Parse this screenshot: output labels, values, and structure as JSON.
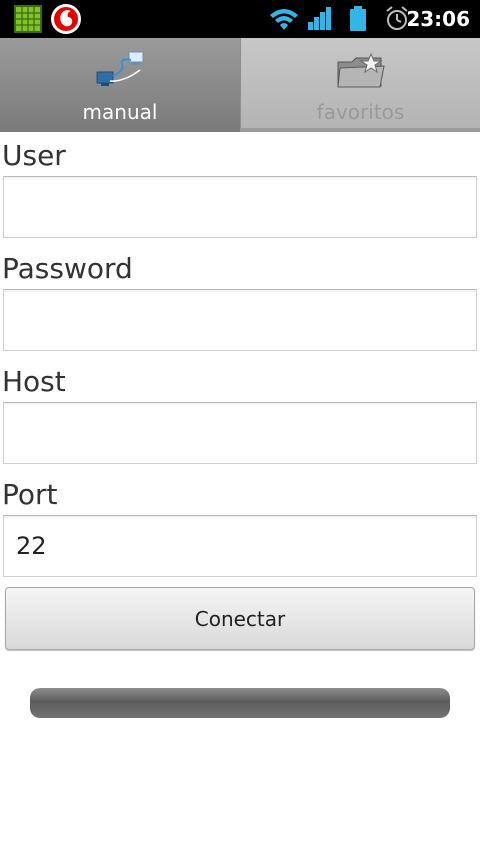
{
  "status_bar": {
    "time": "23:06",
    "icons": [
      "app-grid-icon",
      "vodafone-icon",
      "wifi-icon",
      "signal-icon",
      "battery-icon",
      "alarm-icon"
    ]
  },
  "tabs": [
    {
      "label": "manual",
      "icon": "network-icon",
      "active": true
    },
    {
      "label": "favoritos",
      "icon": "folder-icon",
      "active": false
    }
  ],
  "form": {
    "user": {
      "label": "User",
      "value": ""
    },
    "password": {
      "label": "Password",
      "value": ""
    },
    "host": {
      "label": "Host",
      "value": ""
    },
    "port": {
      "label": "Port",
      "value": "22"
    },
    "connect_label": "Conectar"
  },
  "progress": {
    "fraction": 0
  },
  "colors": {
    "status_bar": "#000000",
    "tab_active": "#8a8a8a",
    "tab_inactive": "#bdbdbd",
    "accent_signal": "#33b5e5"
  }
}
